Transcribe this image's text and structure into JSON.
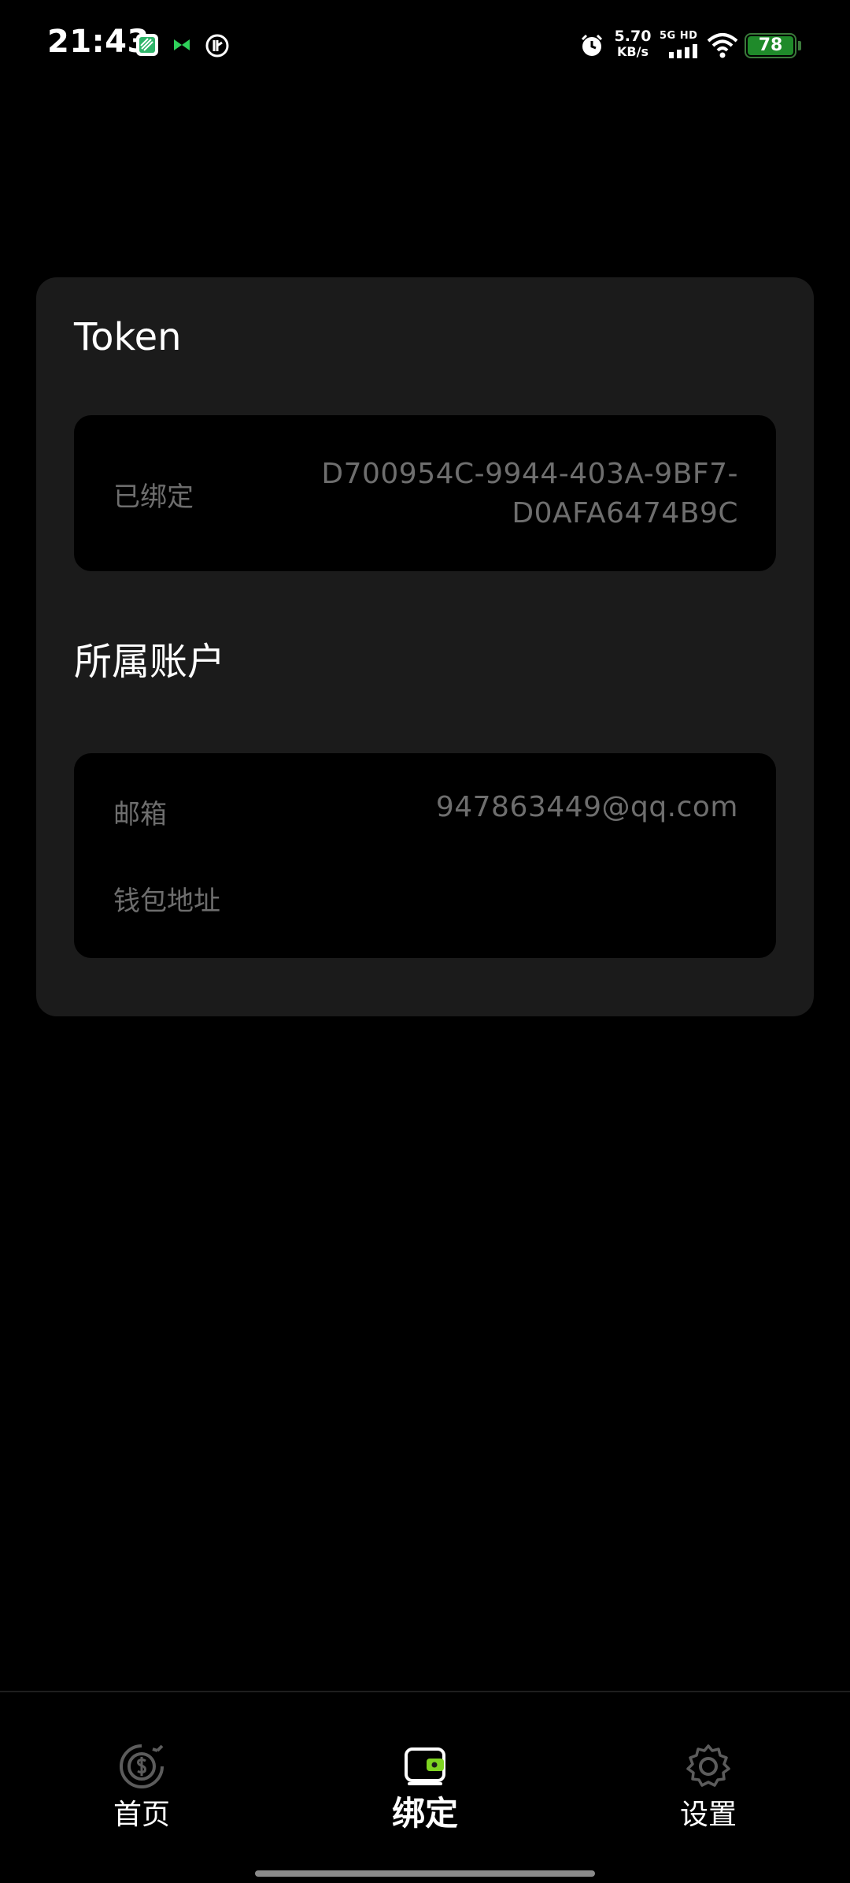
{
  "status_bar": {
    "time": "21:43",
    "net_speed_value": "5.70",
    "net_speed_unit": "KB/s",
    "signal_label": "5G HD",
    "battery_level": "78",
    "icons": [
      "app-notification-icon",
      "game-notification-icon",
      "vpn-icon",
      "alarm-icon",
      "signal-icon",
      "wifi-icon",
      "battery-icon"
    ]
  },
  "token_section": {
    "title": "Token",
    "bound_label": "已绑定",
    "token_value": "D700954C-9944-403A-9BF7-D0AFA6474B9C"
  },
  "account_section": {
    "title": "所属账户",
    "email_label": "邮箱",
    "email_value": "947863449@qq.com",
    "wallet_label": "钱包地址",
    "wallet_value": ""
  },
  "bottom_nav": {
    "active": "bind",
    "items": [
      {
        "key": "home",
        "label": "首页",
        "icon": "dollar-cycle-icon"
      },
      {
        "key": "bind",
        "label": "绑定",
        "icon": "wallet-icon"
      },
      {
        "key": "settings",
        "label": "设置",
        "icon": "gear-icon"
      }
    ]
  },
  "colors": {
    "background": "#000000",
    "card": "#1b1b1b",
    "muted_text": "#6e6e6e",
    "accent_green": "#7ed321",
    "battery_green": "#1f8a2a"
  }
}
